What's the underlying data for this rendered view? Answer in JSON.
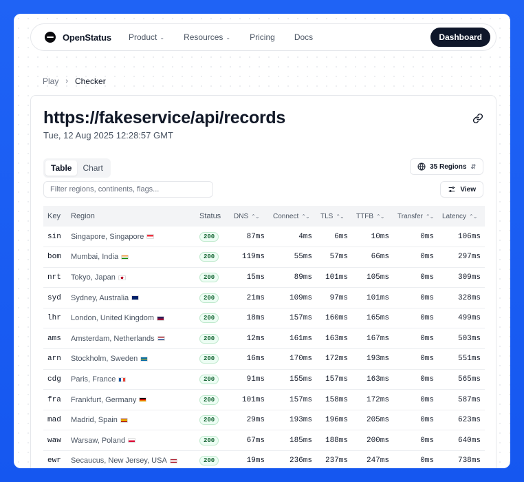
{
  "brand": {
    "name": "OpenStatus"
  },
  "nav": {
    "items": [
      {
        "label": "Product",
        "has_menu": true
      },
      {
        "label": "Resources",
        "has_menu": true
      },
      {
        "label": "Pricing",
        "has_menu": false
      },
      {
        "label": "Docs",
        "has_menu": false
      }
    ],
    "dashboard_label": "Dashboard"
  },
  "breadcrumb": {
    "parent": "Play",
    "current": "Checker"
  },
  "check": {
    "url": "https://fakeservice/api/records",
    "timestamp": "Tue, 12 Aug 2025 12:28:57 GMT"
  },
  "tabs": [
    {
      "label": "Table",
      "active": true
    },
    {
      "label": "Chart",
      "active": false
    }
  ],
  "regions_button": {
    "label": "35 Regions"
  },
  "filter": {
    "placeholder": "Filter regions, continents, flags...",
    "value": ""
  },
  "view_button": {
    "label": "View"
  },
  "table": {
    "columns": [
      {
        "label": "Key",
        "sortable": false
      },
      {
        "label": "Region",
        "sortable": false
      },
      {
        "label": "Status",
        "sortable": false
      },
      {
        "label": "DNS",
        "sortable": true
      },
      {
        "label": "Connect",
        "sortable": true
      },
      {
        "label": "TLS",
        "sortable": true
      },
      {
        "label": "TTFB",
        "sortable": true
      },
      {
        "label": "Transfer",
        "sortable": true
      },
      {
        "label": "Latency",
        "sortable": true
      }
    ],
    "rows": [
      {
        "key": "sin",
        "region": "Singapore, Singapore",
        "flag": "sg",
        "status": "200",
        "dns": "87ms",
        "connect": "4ms",
        "tls": "6ms",
        "ttfb": "10ms",
        "transfer": "0ms",
        "latency": "106ms"
      },
      {
        "key": "bom",
        "region": "Mumbai, India",
        "flag": "in",
        "status": "200",
        "dns": "119ms",
        "connect": "55ms",
        "tls": "57ms",
        "ttfb": "66ms",
        "transfer": "0ms",
        "latency": "297ms"
      },
      {
        "key": "nrt",
        "region": "Tokyo, Japan",
        "flag": "jp",
        "status": "200",
        "dns": "15ms",
        "connect": "89ms",
        "tls": "101ms",
        "ttfb": "105ms",
        "transfer": "0ms",
        "latency": "309ms"
      },
      {
        "key": "syd",
        "region": "Sydney, Australia",
        "flag": "au",
        "status": "200",
        "dns": "21ms",
        "connect": "109ms",
        "tls": "97ms",
        "ttfb": "101ms",
        "transfer": "0ms",
        "latency": "328ms"
      },
      {
        "key": "lhr",
        "region": "London, United Kingdom",
        "flag": "gb",
        "status": "200",
        "dns": "18ms",
        "connect": "157ms",
        "tls": "160ms",
        "ttfb": "165ms",
        "transfer": "0ms",
        "latency": "499ms"
      },
      {
        "key": "ams",
        "region": "Amsterdam, Netherlands",
        "flag": "nl",
        "status": "200",
        "dns": "12ms",
        "connect": "161ms",
        "tls": "163ms",
        "ttfb": "167ms",
        "transfer": "0ms",
        "latency": "503ms"
      },
      {
        "key": "arn",
        "region": "Stockholm, Sweden",
        "flag": "se",
        "status": "200",
        "dns": "16ms",
        "connect": "170ms",
        "tls": "172ms",
        "ttfb": "193ms",
        "transfer": "0ms",
        "latency": "551ms"
      },
      {
        "key": "cdg",
        "region": "Paris, France",
        "flag": "fr",
        "status": "200",
        "dns": "91ms",
        "connect": "155ms",
        "tls": "157ms",
        "ttfb": "163ms",
        "transfer": "0ms",
        "latency": "565ms"
      },
      {
        "key": "fra",
        "region": "Frankfurt, Germany",
        "flag": "de",
        "status": "200",
        "dns": "101ms",
        "connect": "157ms",
        "tls": "158ms",
        "ttfb": "172ms",
        "transfer": "0ms",
        "latency": "587ms"
      },
      {
        "key": "mad",
        "region": "Madrid, Spain",
        "flag": "es",
        "status": "200",
        "dns": "29ms",
        "connect": "193ms",
        "tls": "196ms",
        "ttfb": "205ms",
        "transfer": "0ms",
        "latency": "623ms"
      },
      {
        "key": "waw",
        "region": "Warsaw, Poland",
        "flag": "pl",
        "status": "200",
        "dns": "67ms",
        "connect": "185ms",
        "tls": "188ms",
        "ttfb": "200ms",
        "transfer": "0ms",
        "latency": "640ms"
      },
      {
        "key": "ewr",
        "region": "Secaucus, New Jersey, USA",
        "flag": "us",
        "status": "200",
        "dns": "19ms",
        "connect": "236ms",
        "tls": "237ms",
        "ttfb": "247ms",
        "transfer": "0ms",
        "latency": "738ms"
      }
    ]
  },
  "colors": {
    "page_background": "#1557f0",
    "primary_button": "#0f172a",
    "status_ok_bg": "#ecfdf3",
    "status_ok_text": "#166534"
  }
}
